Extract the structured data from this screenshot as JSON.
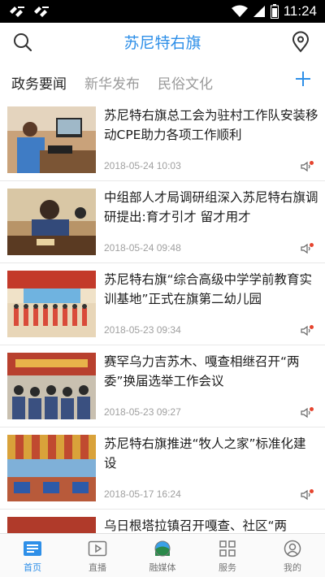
{
  "status_bar": {
    "time": "11:24"
  },
  "header": {
    "title": "苏尼特右旗"
  },
  "tabs": [
    {
      "label": "政务要闻",
      "active": true
    },
    {
      "label": "新华发布",
      "active": false
    },
    {
      "label": "民俗文化",
      "active": false
    }
  ],
  "news": [
    {
      "title": "苏尼特右旗总工会为驻村工作队安装移动CPE助力各项工作顺利",
      "date": "2018-05-24 10:03"
    },
    {
      "title": "中组部人才局调研组深入苏尼特右旗调研提出:育才引才 留才用才",
      "date": "2018-05-24 09:48"
    },
    {
      "title": "苏尼特右旗“综合高级中学学前教育实训基地”正式在旗第二幼儿园",
      "date": "2018-05-23 09:34"
    },
    {
      "title": "赛罕乌力吉苏木、嘎查相继召开“两委”换届选举工作会议",
      "date": "2018-05-23 09:27"
    },
    {
      "title": "苏尼特右旗推进“牧人之家”标准化建设",
      "date": "2018-05-17 16:24"
    },
    {
      "title": "乌日根塔拉镇召开嘎查、社区“两",
      "date": ""
    }
  ],
  "bottom_nav": [
    {
      "label": "首页",
      "active": true,
      "icon": "home-news-icon"
    },
    {
      "label": "直播",
      "active": false,
      "icon": "play-icon"
    },
    {
      "label": "融媒体",
      "active": false,
      "icon": "media-icon"
    },
    {
      "label": "服务",
      "active": false,
      "icon": "grid-icon"
    },
    {
      "label": "我的",
      "active": false,
      "icon": "user-icon"
    }
  ],
  "colors": {
    "accent": "#2e8fe8",
    "badge": "#e5452f"
  }
}
